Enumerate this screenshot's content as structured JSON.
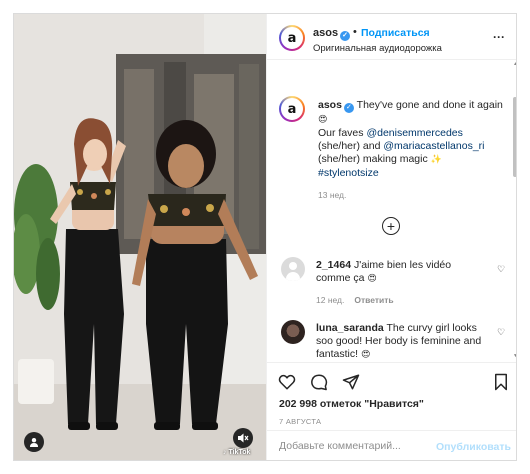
{
  "header": {
    "username": "asos",
    "dot": "•",
    "follow_label": "Подписаться",
    "subtitle": "Оригинальная аудиодорожка",
    "avatar_letter": "a"
  },
  "caption": {
    "username": "asos",
    "text_1": "They've gone and done it again",
    "text_2": "Our faves",
    "mention_1": "@denisemmercedes",
    "pronoun_1": "(she/her) and",
    "mention_2": "@mariacastellanos_ri",
    "pronoun_2": "(she/her) making magic",
    "hashtag": "#stylenotsize",
    "time": "13 нед."
  },
  "comments": [
    {
      "username": "2_1464",
      "text": "J'aime bien les vidéo comme ça",
      "time": "12 нед.",
      "reply_label": "Ответить"
    },
    {
      "username": "luna_saranda",
      "text": "The curvy girl looks soo good! Her body is feminine and fantastic!"
    }
  ],
  "actions": {
    "likes": "202 998 отметок \"Нравится\"",
    "date": "7 АВГУСТА"
  },
  "add_comment": {
    "placeholder": "Добавьте комментарий...",
    "publish_label": "Опубликовать"
  },
  "media": {
    "watermark": "TikTok"
  }
}
